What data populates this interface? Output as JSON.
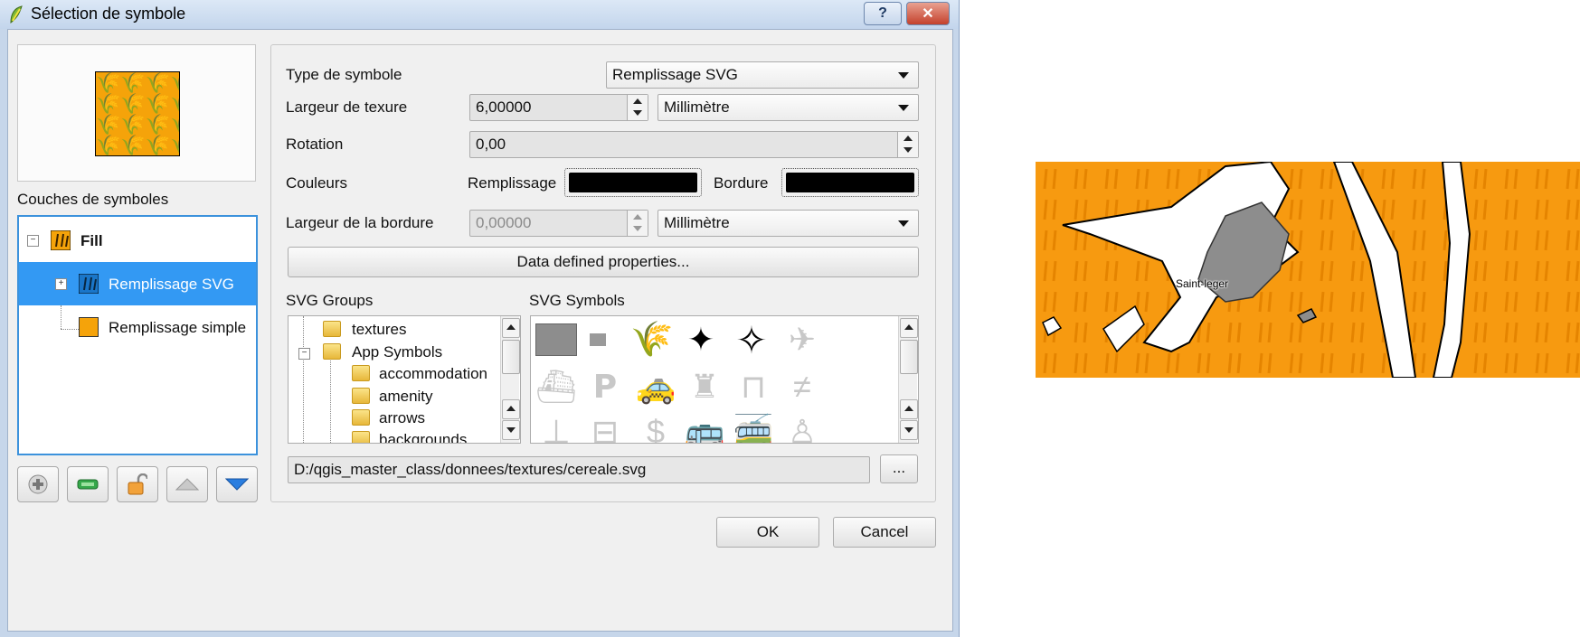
{
  "window": {
    "title": "Sélection de symbole",
    "help_label": "?",
    "close_label": "✕"
  },
  "left": {
    "layers_label": "Couches de symboles",
    "tree": {
      "root": "Fill",
      "items": [
        "Remplissage SVG",
        "Remplissage simple"
      ]
    },
    "toolbar": [
      "add-layer",
      "remove-layer",
      "lock-layer",
      "move-up",
      "move-down"
    ]
  },
  "form": {
    "type_label": "Type de symbole",
    "type_value": "Remplissage SVG",
    "width_label": "Largeur de texure",
    "width_value": "6,00000",
    "width_unit": "Millimètre",
    "rotation_label": "Rotation",
    "rotation_value": "0,00",
    "colors_label": "Couleurs",
    "fill_label": "Remplissage",
    "border_label": "Bordure",
    "fill_color": "#000000",
    "border_color": "#000000",
    "border_width_label": "Largeur de la bordure",
    "border_width_value": "0,00000",
    "border_width_unit": "Millimètre",
    "data_defined_label": "Data defined properties..."
  },
  "svg": {
    "groups_label": "SVG Groups",
    "symbols_label": "SVG Symbols",
    "groups": [
      "textures",
      "App Symbols",
      "accommodation",
      "amenity",
      "arrows",
      "backgrounds"
    ],
    "path": "D:/qgis_master_class/donnees/textures/cereale.svg",
    "browse_label": "..."
  },
  "buttons": {
    "ok": "OK",
    "cancel": "Cancel"
  },
  "map": {
    "place_label": "Saint-leger",
    "fill_color": "#f79a10"
  }
}
